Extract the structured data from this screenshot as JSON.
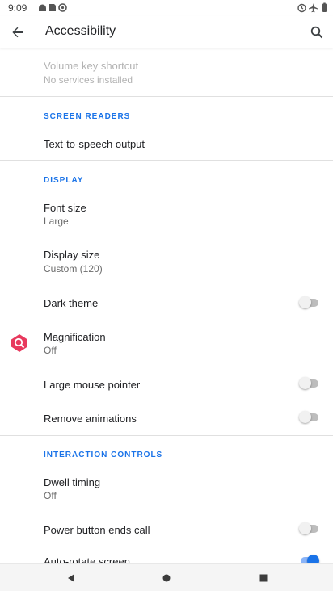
{
  "status_bar": {
    "time": "9:09"
  },
  "app_bar": {
    "title": "Accessibility",
    "back_icon": "arrow-back-icon",
    "search_icon": "search-icon"
  },
  "list": {
    "volume_key_shortcut": {
      "title": "Volume key shortcut",
      "subtitle": "No services installed"
    },
    "screen_readers_header": "SCREEN READERS",
    "text_to_speech": {
      "title": "Text-to-speech output"
    },
    "display_header": "DISPLAY",
    "font_size": {
      "title": "Font size",
      "subtitle": "Large"
    },
    "display_size": {
      "title": "Display size",
      "subtitle": "Custom (120)"
    },
    "dark_theme": {
      "title": "Dark theme",
      "enabled": false
    },
    "magnification": {
      "title": "Magnification",
      "subtitle": "Off",
      "icon": "magnification-icon"
    },
    "large_mouse_pointer": {
      "title": "Large mouse pointer",
      "enabled": false
    },
    "remove_animations": {
      "title": "Remove animations",
      "enabled": false
    },
    "interaction_controls_header": "INTERACTION CONTROLS",
    "dwell_timing": {
      "title": "Dwell timing",
      "subtitle": "Off"
    },
    "power_button_ends_call": {
      "title": "Power button ends call",
      "enabled": false
    },
    "auto_rotate_screen": {
      "title": "Auto-rotate screen",
      "enabled": true
    }
  },
  "colors": {
    "accent": "#1a73e8",
    "magnification_icon": "#e8395d"
  }
}
